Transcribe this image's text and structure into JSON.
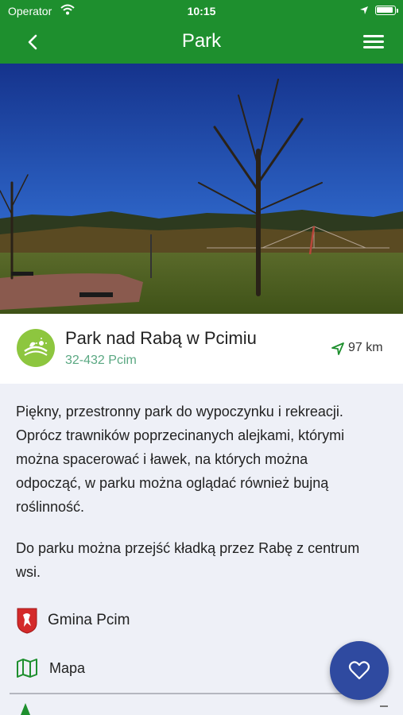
{
  "status_bar": {
    "carrier": "Operator",
    "time": "10:15"
  },
  "nav": {
    "title": "Park"
  },
  "place": {
    "name": "Park nad Rabą w Pcimiu",
    "postal": "32-432 Pcim",
    "distance": "97 km"
  },
  "description": {
    "p1": "Piękny, przestronny park do wypoczynku i rekreacji. Oprócz trawników poprzecinanych alejkami, którymi można spacerować i ławek, na których można odpocząć, w parku można oglądać również bujną roślinność.",
    "p2": "Do parku można przejść kładką przez Rabę z centrum wsi."
  },
  "links": {
    "gmina": "Gmina Pcim",
    "map": "Mapa"
  },
  "colors": {
    "header": "#1e8f2e",
    "fab": "#2f4aa0",
    "category": "#8dc63f",
    "postal": "#5aa882"
  },
  "icons": [
    "wifi-icon",
    "location-arrow-icon",
    "battery-icon",
    "back-chevron-icon",
    "menu-icon",
    "category-leaf-icon",
    "navigation-arrow-icon",
    "coat-of-arms-icon",
    "map-icon",
    "heart-icon"
  ]
}
